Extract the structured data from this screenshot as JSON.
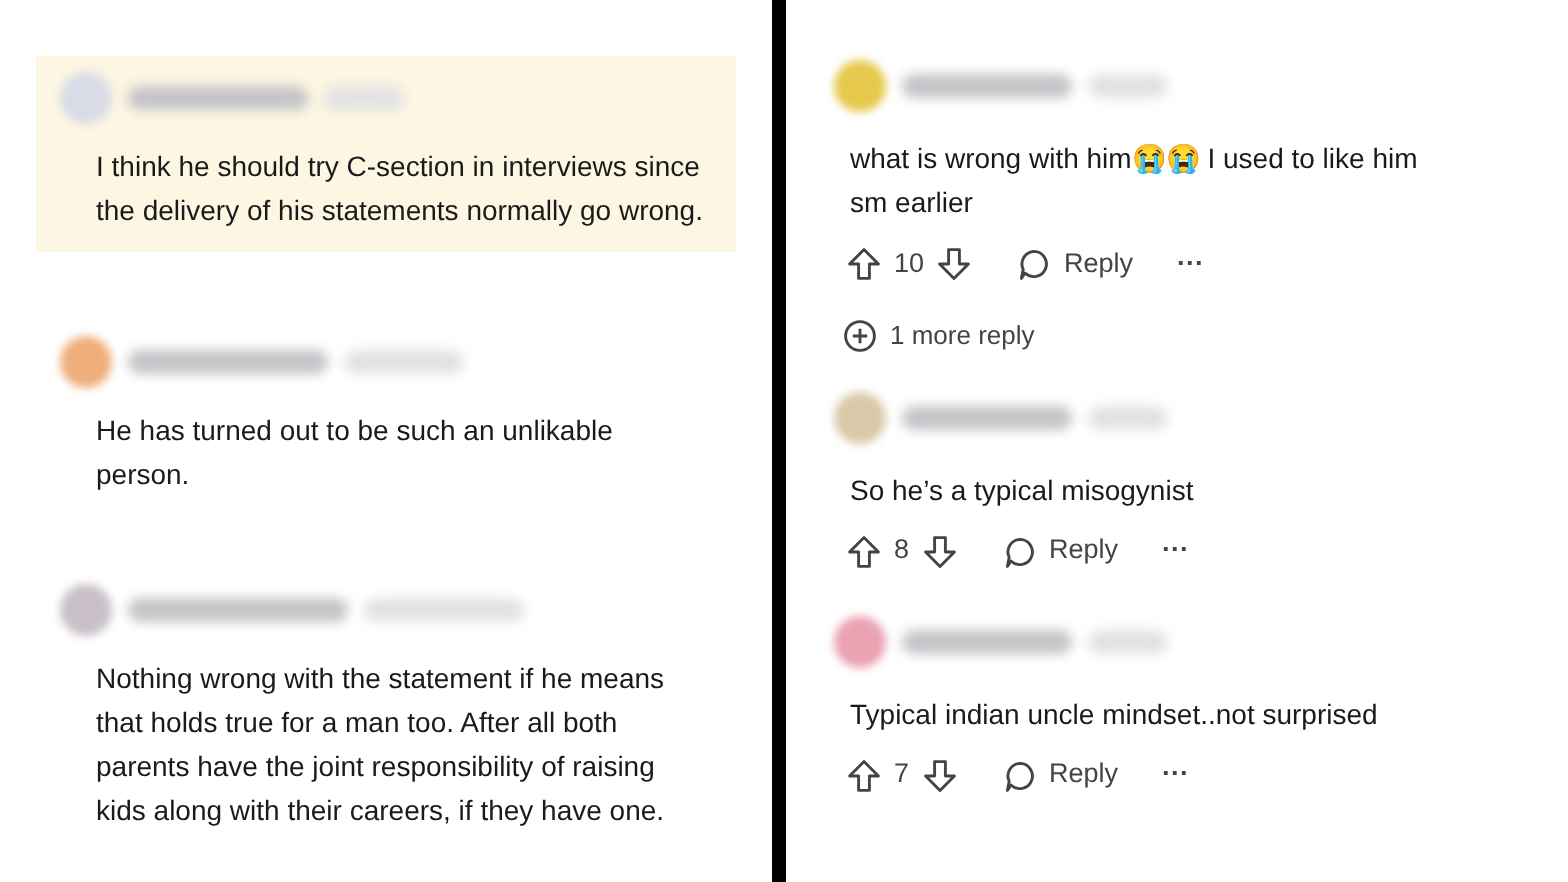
{
  "left_comments": [
    {
      "color": "#d9dbe6",
      "highlighted": true,
      "text": "I think he should try C-section in interviews since the delivery of his statements normally go wrong."
    },
    {
      "color": "#efae7c",
      "highlighted": false,
      "text": "He has turned out to be such an unlikable person."
    },
    {
      "color": "#c9bfc8",
      "highlighted": false,
      "text": "Nothing wrong with the statement if he means that holds true for a man too. After all both parents have the joint responsibility of raising kids along with their careers, if they have one."
    }
  ],
  "right_comments": [
    {
      "color": "#e6c84c",
      "text": "what is wrong with him😭😭 I used to like him sm earlier",
      "votes": "10",
      "reply": "Reply",
      "more": "···",
      "more_replies": "1 more reply"
    },
    {
      "color": "#d9c9a8",
      "text": "So he’s a typical misogynist",
      "votes": "8",
      "reply": "Reply",
      "more": "···"
    },
    {
      "color": "#eaa2b2",
      "text": "Typical indian uncle mindset..not surprised",
      "votes": "7",
      "reply": "Reply",
      "more": "···"
    }
  ]
}
